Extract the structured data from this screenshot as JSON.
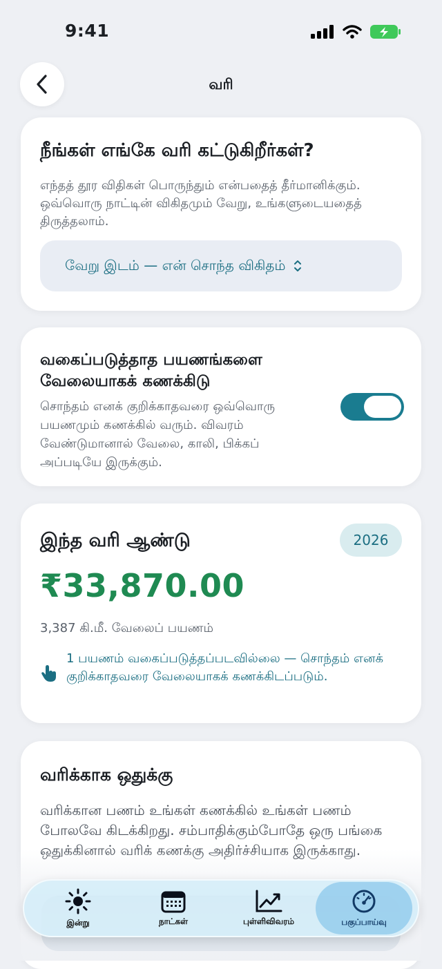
{
  "status_bar": {
    "time": "9:41"
  },
  "header": {
    "title": "வரி"
  },
  "location_card": {
    "title": "நீங்கள் எங்கே வரி கட்டுகிறீர்கள்?",
    "description": "எந்தத் தூர விதிகள் பொருந்தும் என்பதைத் தீர்மானிக்கும். ஒவ்வொரு நாட்டின் விகிதமும் வேறு, உங்களுடையதைத் திருத்தலாம்.",
    "selected_option": "வேறு இடம் — என் சொந்த விகிதம்"
  },
  "toggle_card": {
    "title": "வகைப்படுத்தாத பயணங்களை வேலையாகக் கணக்கிடு",
    "description": "சொந்தம் எனக் குறிக்காதவரை ஒவ்வொரு பயணமும் கணக்கில் வரும். விவரம் வேண்டுமானால் வேலை, காலி, பிக்கப் அப்படியே இருக்கும்.",
    "enabled": true
  },
  "year_card": {
    "title": "இந்த வரி ஆண்டு",
    "year": "2026",
    "amount": "₹33,870.00",
    "distance": "3,387 கி.மீ. வேலைப் பயணம்",
    "note": "1 பயணம் வகைப்படுத்தப்படவில்லை — சொந்தம் எனக் குறிக்காதவரை வேலையாகக் கணக்கிடப்படும்."
  },
  "save_card": {
    "title": "வரிக்காக ஒதுக்கு",
    "body": "வரிக்கான பணம் உங்கள் கணக்கில் உங்கள் பணம் போலவே கிடக்கிறது. சம்பாதிக்கும்போதே ஒரு பங்கை ஒதுக்கினால் வரிக் கணக்கு அதிர்ச்சியாக இருக்காது."
  },
  "tab_bar": {
    "tabs": [
      {
        "label": "இன்று",
        "icon": "sun-icon"
      },
      {
        "label": "நாட்கள்",
        "icon": "calendar-icon"
      },
      {
        "label": "புள்ளிவிவரம்",
        "icon": "chart-icon"
      },
      {
        "label": "பகுப்பாய்வு",
        "icon": "gauge-icon",
        "active": true
      }
    ]
  },
  "colors": {
    "accent": "#1a7c90",
    "amount": "#1f8a52",
    "teal_text": "#1b6e82"
  }
}
